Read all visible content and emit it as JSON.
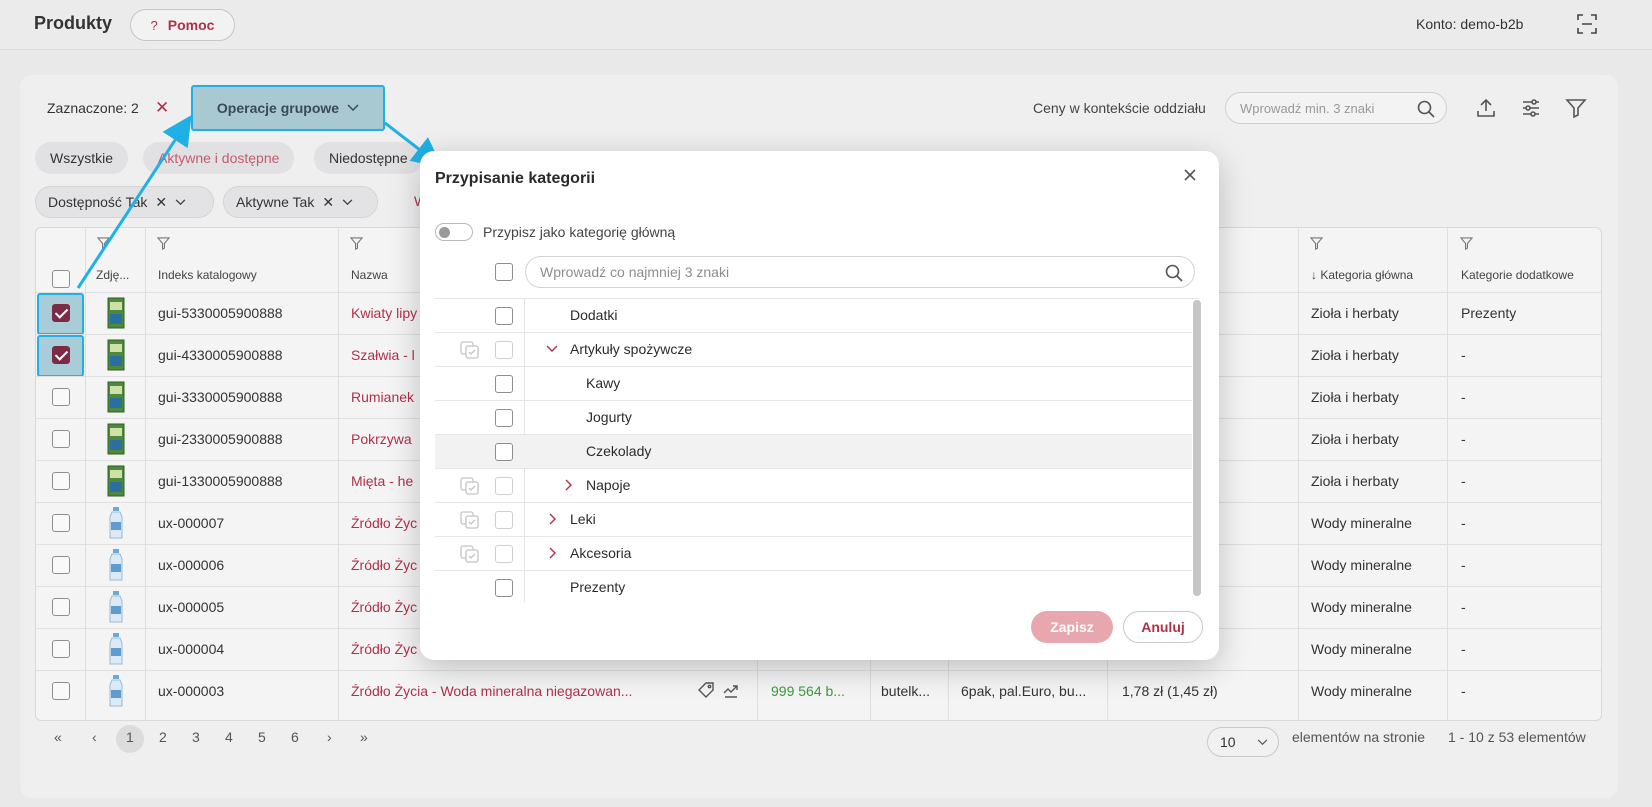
{
  "header": {
    "title": "Produkty",
    "help_label": "Pomoc",
    "help_icon": "?",
    "account": "Konto: demo-b2b"
  },
  "toolbar": {
    "selected_label": "Zaznaczone: 2",
    "group_ops_label": "Operacje grupowe",
    "prices_context_label": "Ceny w kontekście oddziału",
    "prices_context_placeholder": "Wprowadź min. 3 znaki"
  },
  "status_tabs": [
    "Wszystkie",
    "Aktywne i dostępne",
    "Niedostępne"
  ],
  "filters": [
    {
      "label": "Dostępność Tak"
    },
    {
      "label": "Aktywne Tak"
    }
  ],
  "filter_more_fragment": "W",
  "table": {
    "columns": {
      "photo": "Zdję...",
      "index": "Indeks katalogowy",
      "name": "Nazwa",
      "main_category": "↓ Kategoria główna",
      "extra_categories": "Kategorie dodatkowe"
    },
    "rows": [
      {
        "checked": true,
        "index": "gui-5330005900888",
        "name": "Kwiaty lipy",
        "price_fragment": ")",
        "main_category": "Zioła i herbaty",
        "extra": "Prezenty",
        "thumb": "box"
      },
      {
        "checked": true,
        "index": "gui-4330005900888",
        "name": "Szałwia - l",
        "price_fragment": ")",
        "main_category": "Zioła i herbaty",
        "extra": "-",
        "thumb": "box"
      },
      {
        "checked": false,
        "index": "gui-3330005900888",
        "name": "Rumianek",
        "price_fragment": ")",
        "main_category": "Zioła i herbaty",
        "extra": "-",
        "thumb": "box"
      },
      {
        "checked": false,
        "index": "gui-2330005900888",
        "name": "Pokrzywa",
        "price_fragment": ")",
        "main_category": "Zioła i herbaty",
        "extra": "-",
        "thumb": "box"
      },
      {
        "checked": false,
        "index": "gui-1330005900888",
        "name": "Mięta - he",
        "price_fragment": ")",
        "main_category": "Zioła i herbaty",
        "extra": "-",
        "thumb": "box"
      },
      {
        "checked": false,
        "index": "ux-000007",
        "name": "Źródło Życ",
        "price_fragment": ")",
        "main_category": "Wody mineralne",
        "extra": "-",
        "thumb": "bottle"
      },
      {
        "checked": false,
        "index": "ux-000006",
        "name": "Źródło Życ",
        "price_fragment": ")",
        "main_category": "Wody mineralne",
        "extra": "-",
        "thumb": "bottle"
      },
      {
        "checked": false,
        "index": "ux-000005",
        "name": "Źródło Życ",
        "price_fragment": ")",
        "main_category": "Wody mineralne",
        "extra": "-",
        "thumb": "bottle"
      },
      {
        "checked": false,
        "index": "ux-000004",
        "name": "Źródło Życ",
        "price_fragment": ")",
        "main_category": "Wody mineralne",
        "extra": "-",
        "thumb": "bottle"
      },
      {
        "checked": false,
        "index": "ux-000003",
        "name": "Źródło Życia - Woda mineralna niegazowan...",
        "price_fragment": "",
        "main_category": "Wody mineralne",
        "extra": "-",
        "thumb": "bottle",
        "stock": "999 564 b...",
        "unit": "butelk...",
        "packaging": "6pak, pal.Euro, bu...",
        "price": "1,78 zł (1,45 zł)"
      }
    ]
  },
  "pagination": {
    "pages": [
      "1",
      "2",
      "3",
      "4",
      "5",
      "6"
    ],
    "active_page": "1",
    "per_page": "10",
    "per_page_label": "elementów na stronie",
    "range_label": "1 - 10 z 53 elementów"
  },
  "modal": {
    "title": "Przypisanie kategorii",
    "toggle_label": "Przypisz jako kategorię główną",
    "search_placeholder": "Wprowadź co najmniej 3 znaki",
    "tree": [
      {
        "label": "Dodatki",
        "level": 0,
        "expand": "none",
        "multi": false,
        "highlight": false
      },
      {
        "label": "Artykuły spożywcze",
        "level": 0,
        "expand": "open",
        "multi": true,
        "highlight": false
      },
      {
        "label": "Kawy",
        "level": 1,
        "expand": "none",
        "multi": false,
        "highlight": false
      },
      {
        "label": "Jogurty",
        "level": 1,
        "expand": "none",
        "multi": false,
        "highlight": false
      },
      {
        "label": "Czekolady",
        "level": 1,
        "expand": "none",
        "multi": false,
        "highlight": true
      },
      {
        "label": "Napoje",
        "level": 1,
        "expand": "closed",
        "multi": true,
        "highlight": false
      },
      {
        "label": "Leki",
        "level": 0,
        "expand": "closed",
        "multi": true,
        "highlight": false
      },
      {
        "label": "Akcesoria",
        "level": 0,
        "expand": "closed",
        "multi": true,
        "highlight": false
      },
      {
        "label": "Prezenty",
        "level": 0,
        "expand": "none",
        "multi": false,
        "highlight": false
      }
    ],
    "save_label": "Zapisz",
    "cancel_label": "Anuluj"
  },
  "colors": {
    "accent": "#b03048",
    "highlight_border": "#1fb1e6",
    "checkbox_checked": "#7d2a44",
    "save_disabled": "#e8a6ae",
    "stock_green": "#3c9a3c"
  }
}
